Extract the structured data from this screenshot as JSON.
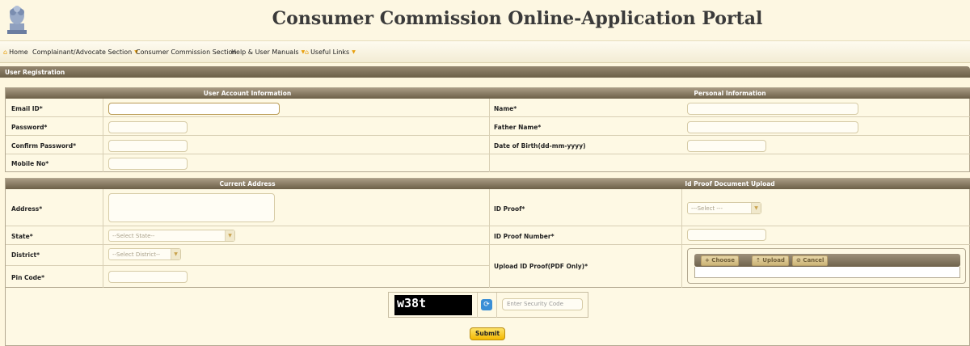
{
  "header": {
    "title": "Consumer Commission Online-Application Portal",
    "logo": "national-emblem"
  },
  "nav": {
    "home": "Home",
    "complainant": "Complainant/Advocate Section",
    "commission": "Consumer Commission Section",
    "help": "Help & User Manuals",
    "links": "Useful Links"
  },
  "section_title": "User Registration",
  "account": {
    "heading": "User Account Information",
    "email_label": "Email ID*",
    "password_label": "Password*",
    "confirm_label": "Confirm Password*",
    "mobile_label": "Mobile No*"
  },
  "personal": {
    "heading": "Personal Information",
    "name_label": "Name*",
    "father_label": "Father Name*",
    "dob_label": "Date of Birth(dd-mm-yyyy)"
  },
  "address": {
    "heading": "Current Address",
    "address_label": "Address*",
    "state_label": "State*",
    "state_value": "--Select State--",
    "district_label": "District*",
    "district_value": "--Select District--",
    "pin_label": "Pin Code*"
  },
  "idproof": {
    "heading": "Id Proof Document Upload",
    "proof_label": "ID Proof*",
    "proof_value": "---Select ---",
    "number_label": "ID Proof Number*",
    "upload_label": "Upload ID Proof(PDF Only)*",
    "choose": "+ Choose",
    "upload": "⇡ Upload",
    "cancel": "⊘ Cancel"
  },
  "captcha": {
    "code": "w38t",
    "placeholder": "Enter Security Code"
  },
  "submit": "Submit",
  "colors": {
    "header_bar": "#7a6e58",
    "background": "#fef7df",
    "submit": "#f7c81a",
    "accent": "#e8a010"
  }
}
